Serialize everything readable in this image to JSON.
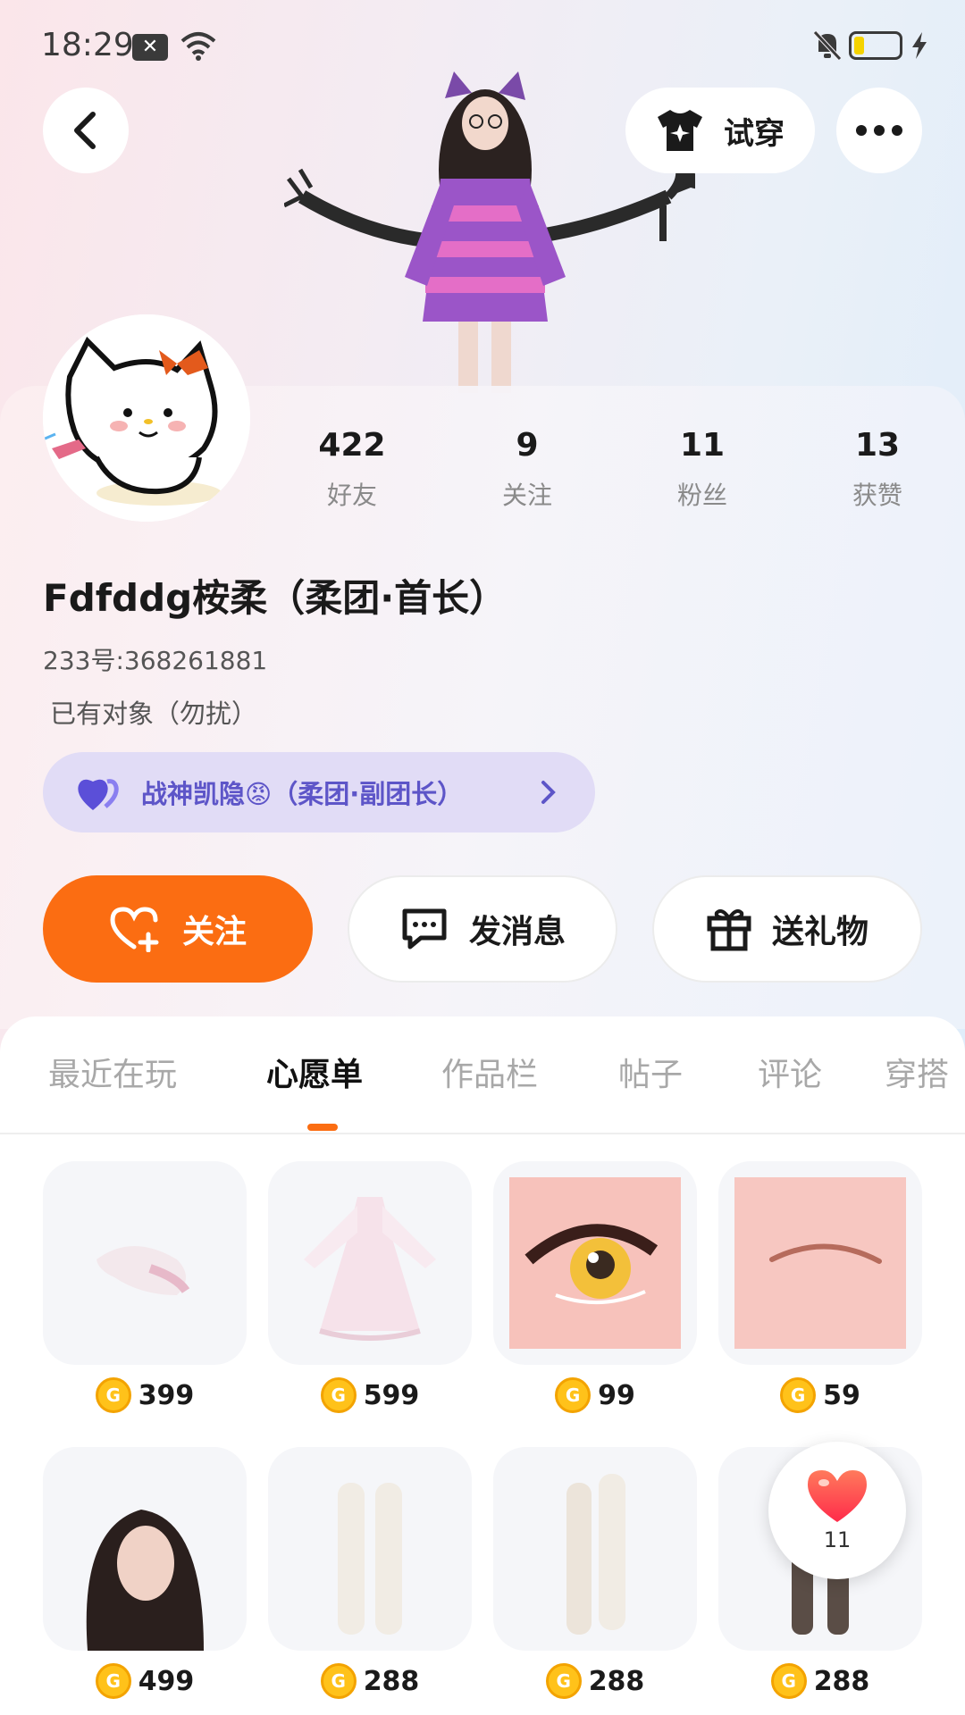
{
  "status_bar": {
    "time": "18:29"
  },
  "header": {
    "try_on_label": "试穿"
  },
  "stats": [
    {
      "value": "422",
      "label": "好友"
    },
    {
      "value": "9",
      "label": "关注"
    },
    {
      "value": "11",
      "label": "粉丝"
    },
    {
      "value": "13",
      "label": "获赞"
    }
  ],
  "profile": {
    "nickname": "Fdfddg桉柔（柔团·首长）",
    "uid": "233号:368261881",
    "bio": "已有对象（勿扰）",
    "cp_label": "战神凯隐😡（柔团·副团长）"
  },
  "actions": {
    "follow": "关注",
    "message": "发消息",
    "gift": "送礼物"
  },
  "tabs": [
    {
      "label": "最近在玩"
    },
    {
      "label": "心愿单"
    },
    {
      "label": "作品栏"
    },
    {
      "label": "帖子"
    },
    {
      "label": "评论"
    },
    {
      "label": "穿搭"
    }
  ],
  "active_tab": "心愿单",
  "wishlist": [
    {
      "item": "tail",
      "price": "399"
    },
    {
      "item": "pink-dress",
      "price": "599"
    },
    {
      "item": "eye",
      "price": "99"
    },
    {
      "item": "brow",
      "price": "59"
    },
    {
      "item": "black-hair",
      "price": "499"
    },
    {
      "item": "white-stockings",
      "price": "288"
    },
    {
      "item": "white-stockings-2",
      "price": "288"
    },
    {
      "item": "dark-stockings",
      "price": "288"
    }
  ],
  "like_fab": {
    "count": "11"
  },
  "colors": {
    "accent": "#fb6d12",
    "cp_pill_bg": "#e1dcf6",
    "cp_text": "#5d55c8",
    "coin": "#ffc21a"
  }
}
